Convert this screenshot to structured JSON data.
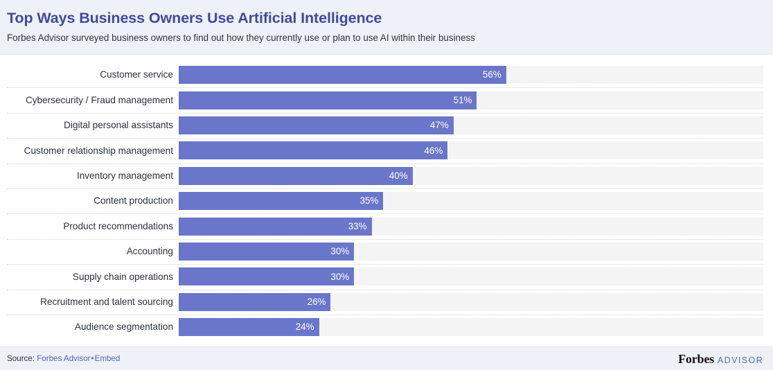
{
  "header": {
    "title": "Top Ways Business Owners Use Artificial Intelligence",
    "subtitle": "Forbes Advisor surveyed business owners to find out how they currently use or plan to use AI within their business"
  },
  "footer": {
    "source_prefix": "Source:",
    "source_name": "Forbes Advisor",
    "source_separator": "•",
    "source_embed": "Embed",
    "brand_primary": "Forbes",
    "brand_secondary": "ADVISOR"
  },
  "colors": {
    "bar": "#6a76c9",
    "track": "#f4f4f4",
    "title": "#3f4b9e",
    "label": "#2b3040",
    "panel": "#eef1f7",
    "link": "#5560b5"
  },
  "chart_data": {
    "type": "bar",
    "orientation": "horizontal",
    "title": "Top Ways Business Owners Use Artificial Intelligence",
    "subtitle": "Forbes Advisor surveyed business owners to find out how they currently use or plan to use AI within their business",
    "xlabel": "",
    "ylabel": "",
    "xlim": [
      0,
      100
    ],
    "grid": false,
    "legend": "none",
    "value_suffix": "%",
    "categories": [
      "Customer service",
      "Cybersecurity / Fraud management",
      "Digital personal assistants",
      "Customer relationship management",
      "Inventory management",
      "Content production",
      "Product recommendations",
      "Accounting",
      "Supply chain operations",
      "Recruitment and talent sourcing",
      "Audience segmentation"
    ],
    "values": [
      56,
      51,
      47,
      46,
      40,
      35,
      33,
      30,
      30,
      26,
      24
    ],
    "labels": [
      "56%",
      "51%",
      "47%",
      "46%",
      "40%",
      "35%",
      "33%",
      "30%",
      "30%",
      "26%",
      "24%"
    ]
  }
}
